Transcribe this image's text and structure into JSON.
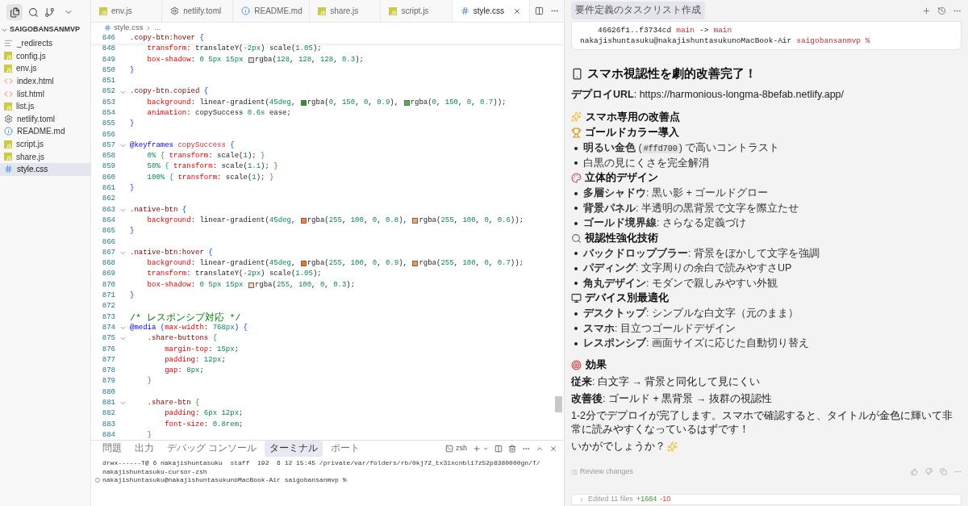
{
  "sidebar": {
    "project": "SAIGOBANSANMVP",
    "files": [
      {
        "name": "_redirects",
        "kind": "text",
        "selected": false
      },
      {
        "name": "config.js",
        "kind": "js",
        "selected": false
      },
      {
        "name": "env.js",
        "kind": "js",
        "selected": false
      },
      {
        "name": "index.html",
        "kind": "html",
        "selected": false
      },
      {
        "name": "list.html",
        "kind": "html",
        "selected": false
      },
      {
        "name": "list.js",
        "kind": "js",
        "selected": false
      },
      {
        "name": "netlify.toml",
        "kind": "config",
        "selected": false
      },
      {
        "name": "README.md",
        "kind": "info",
        "selected": false
      },
      {
        "name": "script.js",
        "kind": "js",
        "selected": false
      },
      {
        "name": "share.js",
        "kind": "js",
        "selected": false
      },
      {
        "name": "style.css",
        "kind": "css",
        "selected": true
      }
    ]
  },
  "editor": {
    "tabs": [
      {
        "label": "env.js",
        "kind": "js",
        "selected": false
      },
      {
        "label": "netlify.toml",
        "kind": "config",
        "selected": false
      },
      {
        "label": "README.md",
        "kind": "info",
        "selected": false
      },
      {
        "label": "share.js",
        "kind": "js",
        "selected": false
      },
      {
        "label": "script.js",
        "kind": "js",
        "selected": false
      },
      {
        "label": "style.css",
        "kind": "css",
        "selected": true
      }
    ],
    "breadcrumb": {
      "file": "style.css",
      "rest": "..."
    },
    "sticky_line": {
      "num": "846",
      "text": ".copy-btn:hover {"
    },
    "lines": [
      {
        "num": "848",
        "foldable": false,
        "text": "    transform: translateY(-2px) scale(1.05);"
      },
      {
        "num": "849",
        "foldable": false,
        "text": "    box-shadow: 0 5px 15px rgba(128, 128, 128, 0.3);"
      },
      {
        "num": "850",
        "foldable": false,
        "text": "}"
      },
      {
        "num": "851",
        "foldable": false
      },
      {
        "num": "852",
        "foldable": true,
        "text": ".copy-btn.copied {"
      },
      {
        "num": "853",
        "foldable": false,
        "text": "    background: linear-gradient(45deg, rgba(0, 150, 0, 0.9), rgba(0, 150, 0, 0.7));"
      },
      {
        "num": "854",
        "foldable": false,
        "text": "    animation: copySuccess 0.6s ease;"
      },
      {
        "num": "855",
        "foldable": false,
        "text": "}"
      },
      {
        "num": "856",
        "foldable": false
      },
      {
        "num": "857",
        "foldable": true,
        "text": "@keyframes copySuccess {"
      },
      {
        "num": "858",
        "foldable": false,
        "text": "    0% { transform: scale(1); }"
      },
      {
        "num": "859",
        "foldable": false,
        "text": "    50% { transform: scale(1.1); }"
      },
      {
        "num": "860",
        "foldable": false,
        "text": "    100% { transform: scale(1); }"
      },
      {
        "num": "861",
        "foldable": false,
        "text": "}"
      },
      {
        "num": "862",
        "foldable": false
      },
      {
        "num": "863",
        "foldable": true,
        "text": ".native-btn {"
      },
      {
        "num": "864",
        "foldable": false,
        "text": "    background: linear-gradient(45deg, rgba(255, 100, 0, 0.8), rgba(255, 100, 0, 0.6));"
      },
      {
        "num": "865",
        "foldable": false,
        "text": "}"
      },
      {
        "num": "866",
        "foldable": false
      },
      {
        "num": "867",
        "foldable": true,
        "text": ".native-btn:hover {"
      },
      {
        "num": "868",
        "foldable": false,
        "text": "    background: linear-gradient(45deg, rgba(255, 100, 0, 0.9), rgba(255, 100, 0, 0.7));"
      },
      {
        "num": "869",
        "foldable": false,
        "text": "    transform: translateY(-2px) scale(1.05);"
      },
      {
        "num": "870",
        "foldable": false,
        "text": "    box-shadow: 0 5px 15px rgba(255, 100, 0, 0.3);"
      },
      {
        "num": "871",
        "foldable": false,
        "text": "}"
      },
      {
        "num": "872",
        "foldable": false
      },
      {
        "num": "873",
        "foldable": false,
        "text": "/* レスポンシブ対応 */"
      },
      {
        "num": "874",
        "foldable": true,
        "text": "@media (max-width: 768px) {"
      },
      {
        "num": "875",
        "foldable": true,
        "text": "    .share-buttons {"
      },
      {
        "num": "876",
        "foldable": false,
        "text": "        margin-top: 15px;"
      },
      {
        "num": "877",
        "foldable": false,
        "text": "        padding: 12px;"
      },
      {
        "num": "878",
        "foldable": false,
        "text": "        gap: 8px;"
      },
      {
        "num": "879",
        "foldable": false,
        "text": "    }"
      },
      {
        "num": "880",
        "foldable": false
      },
      {
        "num": "881",
        "foldable": true,
        "text": "    .share-btn {"
      },
      {
        "num": "882",
        "foldable": false,
        "text": "        padding: 6px 12px;"
      },
      {
        "num": "883",
        "foldable": false,
        "text": "        font-size: 0.8rem;"
      },
      {
        "num": "884",
        "foldable": false,
        "text": "    }"
      }
    ]
  },
  "panel": {
    "tabs": [
      {
        "label": "問題",
        "selected": false
      },
      {
        "label": "出力",
        "selected": false
      },
      {
        "label": "デバッグ コンソール",
        "selected": false
      },
      {
        "label": "ターミナル",
        "selected": true
      },
      {
        "label": "ポート",
        "selected": false
      }
    ],
    "shell": "zsh",
    "terminal": [
      "drwx------T@ 6 nakajishuntasuku  staff  192  6 12 15:45 /private/var/folders/rb/0kj72_tx31xcnbl17z52p8380000gn/T/",
      "nakajishuntasuku-cursor-zsh"
    ],
    "prompt": "nakajishuntasuku@nakajishuntasukunoMacBook-Air saigobansanmvp %"
  },
  "chat": {
    "title": "要件定義のタスクリスト作成",
    "terminal_block": [
      [
        {
          "text": "46626f1..f3734cd",
          "highlighted": false
        },
        {
          "text": "main",
          "highlighted": true
        },
        {
          "text": "->",
          "highlighted": false
        },
        {
          "text": "main",
          "highlighted": true
        }
      ],
      [
        {
          "text": "nakajishuntasuku@nakajishuntasukunoMacBook-Air",
          "highlighted": false
        },
        {
          "text": "saigobansanmvp %",
          "highlighted": true
        }
      ]
    ],
    "blocks": [
      {
        "kind": "h1",
        "text": "スマホ視認性を劇的改善完了！"
      },
      {
        "kind": "p",
        "text": "**デプロイURL**: https://harmonious-longma-8befab.netlify.app/"
      },
      {
        "kind": "h2",
        "text": "スマホ専用の改善点"
      },
      {
        "kind": "h3",
        "text": "ゴールドカラー導入"
      },
      {
        "kind": "li",
        "parts": [
          {
            "kind": "text",
            "text": "**明るい金色** ("
          },
          {
            "kind": "code",
            "text": "#ffd700"
          },
          {
            "kind": "text",
            "text": ") で高いコントラスト"
          }
        ]
      },
      {
        "kind": "li",
        "parts": [
          {
            "kind": "text",
            "text": "白黒の見にくさを完全解消"
          }
        ]
      },
      {
        "kind": "h3",
        "text": "立体的デザイン"
      },
      {
        "kind": "li",
        "parts": [
          {
            "kind": "text",
            "text": "**多層シャドウ**: 黒い影 + ゴールドグロー"
          }
        ]
      },
      {
        "kind": "li",
        "parts": [
          {
            "kind": "text",
            "text": "**背景パネル**: 半透明の黒背景で文字を際立たせ"
          }
        ]
      },
      {
        "kind": "li",
        "parts": [
          {
            "kind": "text",
            "text": "**ゴールド境界線**: さらなる定義づけ"
          }
        ]
      },
      {
        "kind": "h3",
        "text": "視認性強化技術"
      },
      {
        "kind": "li",
        "parts": [
          {
            "kind": "text",
            "text": "**バックドロップブラー**: 背景をぼかして文字を強調"
          }
        ]
      },
      {
        "kind": "li",
        "parts": [
          {
            "kind": "text",
            "text": "**パディング**: 文字周りの余白で読みやすさUP"
          }
        ]
      },
      {
        "kind": "li",
        "parts": [
          {
            "kind": "text",
            "text": "**角丸デザイン**: モダンで親しみやすい外観"
          }
        ]
      },
      {
        "kind": "h3",
        "text": "デバイス別最適化"
      },
      {
        "kind": "li",
        "parts": [
          {
            "kind": "text",
            "text": "**デスクトップ**: シンプルな白文字（元のまま）"
          }
        ]
      },
      {
        "kind": "li",
        "parts": [
          {
            "kind": "text",
            "text": "**スマホ**: 目立つゴールドデザイン"
          }
        ]
      },
      {
        "kind": "li",
        "parts": [
          {
            "kind": "text",
            "text": "**レスポンシブ**: 画面サイズに応じた自動切り替え"
          }
        ]
      },
      {
        "kind": "h2",
        "text": "効果"
      },
      {
        "kind": "p",
        "text": "**従来**: 白文字 → 背景と同化して見にくい"
      },
      {
        "kind": "p",
        "text": "**改善後**: ゴールド + 黒背景 → 抜群の視認性"
      },
      {
        "kind": "p",
        "text": "1-2分でデプロイが完了します。スマホで確認すると、タイトルが金色に輝いて非常に読みやすくなっているはずです！"
      },
      {
        "kind": "p",
        "text": "いかがでしょうか？"
      }
    ],
    "review": "Review changes",
    "edited": {
      "label": "Edited 11 files",
      "added": "+1684",
      "removed": "-10"
    }
  }
}
